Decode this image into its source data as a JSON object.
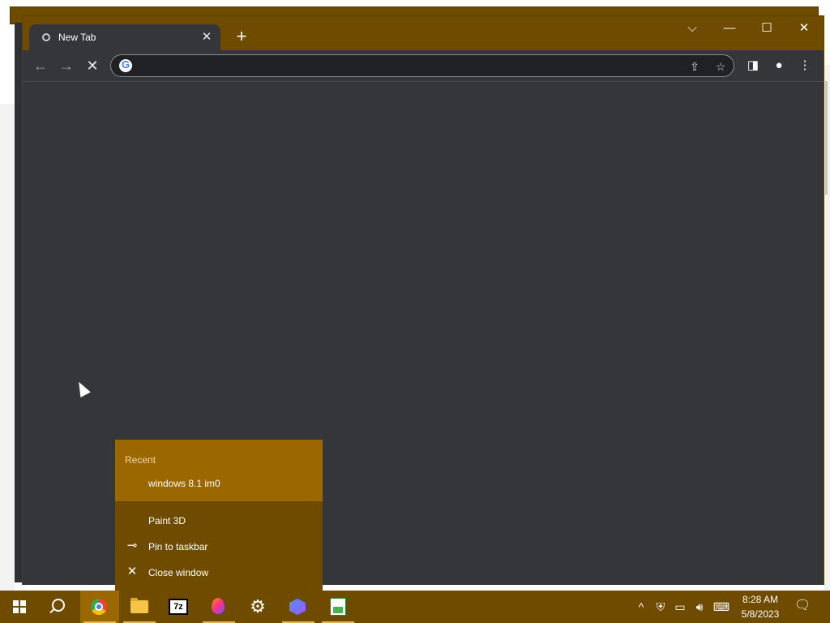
{
  "browser": {
    "tab": {
      "label": "New Tab"
    },
    "new_tab_symbol": "+",
    "omnibox": {
      "value": "",
      "placeholder": ""
    },
    "window_controls": {
      "tab_search": "⌵",
      "minimize": "—",
      "maximize": "☐",
      "close": "✕"
    }
  },
  "jumplist": {
    "header": "Recent",
    "recent_items": [
      {
        "label": "windows 8.1 im0"
      }
    ],
    "tasks": [
      {
        "label": "Paint 3D"
      },
      {
        "label": "Pin to taskbar",
        "icon": "pin-icon"
      },
      {
        "label": "Close window",
        "icon": "close-icon"
      }
    ]
  },
  "taskbar": {
    "apps": [
      "start",
      "search",
      "chrome",
      "file-explorer",
      "7zip",
      "paint-3d",
      "settings",
      "photos",
      "spreadsheet"
    ],
    "sevenz_label": "7z",
    "clock": {
      "time": "8:28 AM",
      "date": "5/8/2023"
    }
  },
  "colors": {
    "accent": "#6f4b00",
    "accent_light": "#9a6700",
    "browser_bg": "#35363a"
  }
}
